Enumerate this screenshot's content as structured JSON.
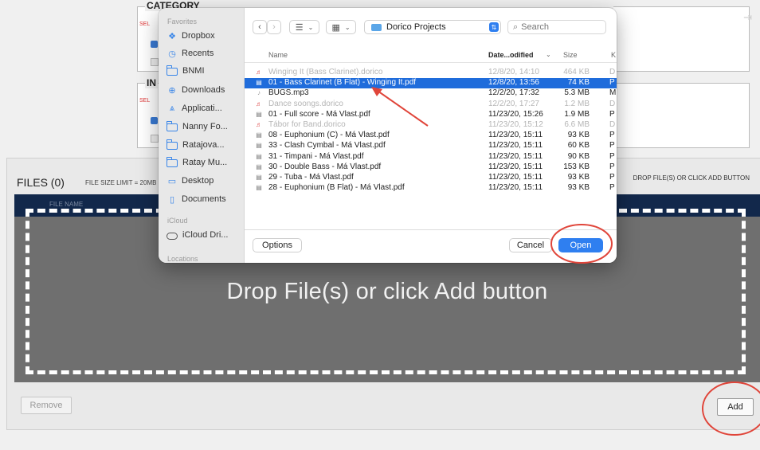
{
  "background_page": {
    "category_legend": "CATEGORY",
    "instrument_legend": "IN",
    "mini_label_1": "SEL",
    "mini_label_2": "SEL",
    "files_title": "FILES (0)",
    "file_size_limit": "FILE SIZE LIMIT = 20MB",
    "drop_hint_top": "DROP FILE(S) OR CLICK ADD BUTTON",
    "dropzone_header": "FILE NAME",
    "dropzone_text": "Drop File(s) or click Add button",
    "remove_label": "Remove",
    "add_label": "Add",
    "exit_icon": "exit-icon"
  },
  "dialog": {
    "sidebar": {
      "sections": [
        {
          "title": "Favorites"
        },
        {
          "title": "iCloud"
        },
        {
          "title": "Locations"
        }
      ],
      "favorites": [
        {
          "label": "Dropbox",
          "icon": "dropbox-icon"
        },
        {
          "label": "Recents",
          "icon": "clock-icon"
        },
        {
          "label": "BNMI",
          "icon": "folder-icon"
        },
        {
          "label": "Downloads",
          "icon": "download-icon"
        },
        {
          "label": "Applicati...",
          "icon": "applications-icon"
        },
        {
          "label": "Nanny Fo...",
          "icon": "folder-icon"
        },
        {
          "label": "Ratajova...",
          "icon": "folder-icon"
        },
        {
          "label": "Ratay Mu...",
          "icon": "folder-icon"
        },
        {
          "label": "Desktop",
          "icon": "desktop-icon"
        },
        {
          "label": "Documents",
          "icon": "document-icon"
        }
      ],
      "icloud": [
        {
          "label": "iCloud Dri...",
          "icon": "cloud-icon"
        }
      ]
    },
    "toolbar": {
      "current_folder": "Dorico Projects",
      "search_placeholder": "Search"
    },
    "columns": {
      "name": "Name",
      "date": "Date...odified",
      "size": "Size",
      "kind": "K"
    },
    "files": [
      {
        "name": "Winging It (Bass Clarinet).dorico",
        "date": "12/8/20, 14:10",
        "size": "464 KB",
        "kind": "D",
        "type": "dorico",
        "state": "disabled"
      },
      {
        "name": "01 - Bass Clarinet (B Flat) - Winging It.pdf",
        "date": "12/8/20, 13:56",
        "size": "74 KB",
        "kind": "P",
        "type": "pdf",
        "state": "selected"
      },
      {
        "name": "BUGS.mp3",
        "date": "12/2/20, 17:32",
        "size": "5.3 MB",
        "kind": "M",
        "type": "mp3",
        "state": "normal"
      },
      {
        "name": "Dance soongs.dorico",
        "date": "12/2/20, 17:27",
        "size": "1.2 MB",
        "kind": "D",
        "type": "dorico",
        "state": "disabled"
      },
      {
        "name": "01 - Full score - Má Vlast.pdf",
        "date": "11/23/20, 15:26",
        "size": "1.9 MB",
        "kind": "P",
        "type": "pdf",
        "state": "normal"
      },
      {
        "name": "Tábor for Band.dorico",
        "date": "11/23/20, 15:12",
        "size": "6.6 MB",
        "kind": "D",
        "type": "dorico",
        "state": "disabled"
      },
      {
        "name": "08 - Euphonium (C) - Má Vlast.pdf",
        "date": "11/23/20, 15:11",
        "size": "93 KB",
        "kind": "P",
        "type": "pdf",
        "state": "normal"
      },
      {
        "name": "33 - Clash Cymbal - Má Vlast.pdf",
        "date": "11/23/20, 15:11",
        "size": "60 KB",
        "kind": "P",
        "type": "pdf",
        "state": "normal"
      },
      {
        "name": "31 - Timpani - Má Vlast.pdf",
        "date": "11/23/20, 15:11",
        "size": "90 KB",
        "kind": "P",
        "type": "pdf",
        "state": "normal"
      },
      {
        "name": "30 - Double Bass - Má Vlast.pdf",
        "date": "11/23/20, 15:11",
        "size": "153 KB",
        "kind": "P",
        "type": "pdf",
        "state": "normal"
      },
      {
        "name": "29 - Tuba - Má Vlast.pdf",
        "date": "11/23/20, 15:11",
        "size": "93 KB",
        "kind": "P",
        "type": "pdf",
        "state": "normal"
      },
      {
        "name": "28 - Euphonium (B Flat) - Má Vlast.pdf",
        "date": "11/23/20, 15:11",
        "size": "93 KB",
        "kind": "P",
        "type": "pdf",
        "state": "normal"
      }
    ],
    "buttons": {
      "options": "Options",
      "cancel": "Cancel",
      "open": "Open"
    }
  },
  "colors": {
    "accent": "#2f7ff0",
    "selection": "#1f6cdb",
    "annotation": "#e0453a",
    "dropzone_header": "#12284b",
    "dropzone": "#6f6f6f"
  }
}
